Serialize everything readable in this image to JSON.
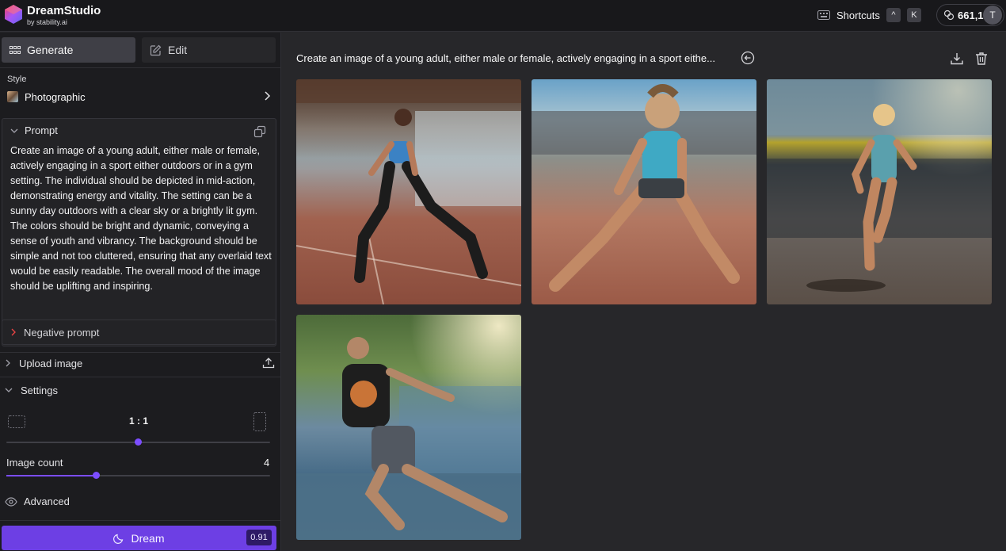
{
  "app": {
    "title": "DreamStudio",
    "subtitle": "by stability.ai"
  },
  "topbar": {
    "shortcuts_label": "Shortcuts",
    "shortcut_keys": [
      "^",
      "K"
    ],
    "credits": "661,1",
    "avatar_initial": "T"
  },
  "sidebar": {
    "tabs": [
      {
        "label": "Generate",
        "active": true
      },
      {
        "label": "Edit",
        "active": false
      }
    ],
    "style": {
      "label": "Style",
      "value": "Photographic"
    },
    "prompt": {
      "label": "Prompt",
      "text": "Create an image of a young adult, either male or female, actively engaging in a sport either outdoors or in a gym setting. The individual should be depicted in mid-action, demonstrating energy and vitality. The setting can be a sunny day outdoors with a clear sky or a brightly lit gym. The colors should be bright and dynamic, conveying a sense of youth and vibrancy. The background should be simple and not too cluttered, ensuring that any overlaid text would be easily readable. The overall mood of the image should be uplifting and inspiring."
    },
    "negative_prompt_label": "Negative prompt",
    "upload_image_label": "Upload image",
    "settings": {
      "label": "Settings",
      "aspect_ratio": "1 : 1",
      "aspect_position": 0.5,
      "image_count_label": "Image count",
      "image_count": "4",
      "image_count_position": 0.34,
      "advanced_label": "Advanced"
    },
    "dream_button": {
      "label": "Dream",
      "cost": "0.91"
    }
  },
  "main": {
    "prompt_title": "Create an image of a young adult, either male or female, actively engaging in a sport eithe...",
    "images": [
      {
        "name": "generated-image-1"
      },
      {
        "name": "generated-image-2"
      },
      {
        "name": "generated-image-3"
      },
      {
        "name": "generated-image-4"
      }
    ]
  },
  "colors": {
    "accent": "#6d3fe4",
    "slider": "#7c4dff",
    "background": "#27272a",
    "sidebar": "#1c1c1f",
    "topbar": "#18181b"
  }
}
